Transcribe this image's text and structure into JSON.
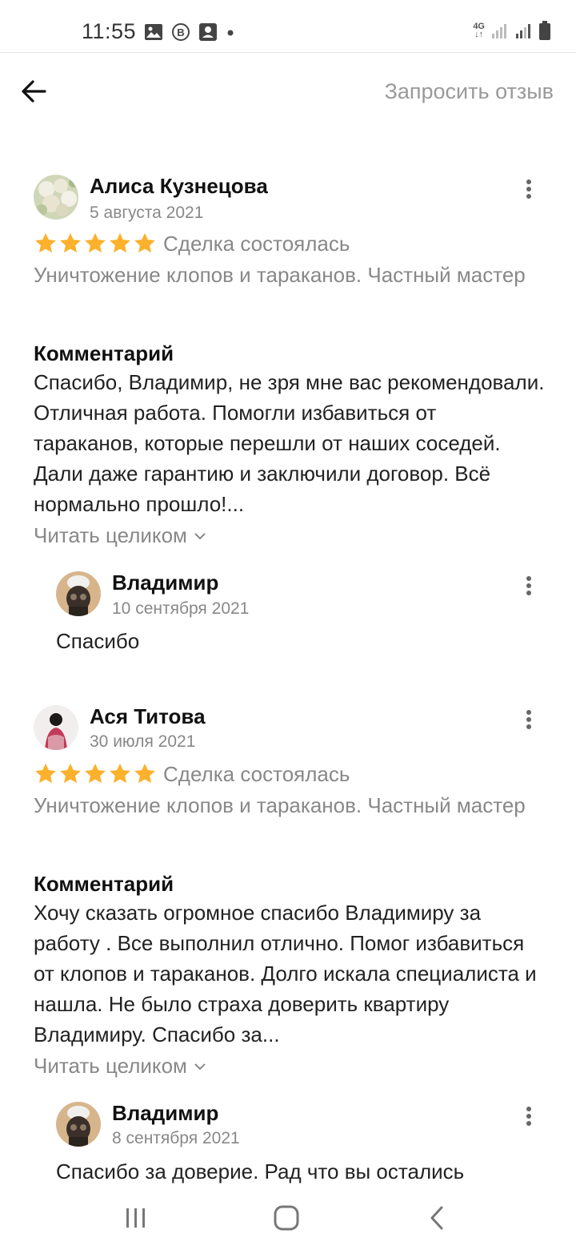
{
  "status_bar": {
    "time": "11:55",
    "network": "4G",
    "icons": [
      "gallery-icon",
      "b-badge-icon",
      "contact-icon",
      "dot-icon",
      "signal-icon",
      "signal-icon",
      "battery-icon"
    ]
  },
  "header": {
    "request_review_label": "Запросить отзыв",
    "back_icon": "arrow-left-icon"
  },
  "reviews": [
    {
      "author": "Алиса Кузнецова",
      "date": "5 августа 2021",
      "rating": 5,
      "deal_status": "Сделка состоялась",
      "service": "Уничтожение клопов и тараканов. Частный мастер",
      "comment_title": "Комментарий",
      "comment": "Спасибо, Владимир, не зря мне вас рекомендовали. Отличная работа. Помогли избавиться от тараканов, которые перешли от наших соседей. Дали даже гарантию и заключили договор. Всё нормально прошло!...",
      "read_more": "Читать целиком",
      "reply": {
        "author": "Владимир",
        "date": "10 сентября 2021",
        "text": "Спасибо"
      }
    },
    {
      "author": "Ася Титова",
      "date": "30 июля 2021",
      "rating": 5,
      "deal_status": "Сделка состоялась",
      "service": "Уничтожение клопов и тараканов. Частный мастер",
      "comment_title": "Комментарий",
      "comment": "Хочу сказать огромное спасибо Владимиру за работу . Все выполнил отлично. Помог избавиться от клопов и тараканов. Долго искала специалиста и нашла. Не было страха доверить квартиру Владимиру. Спасибо за...",
      "read_more": "Читать целиком",
      "reply": {
        "author": "Владимир",
        "date": "8 сентября 2021",
        "text": "Спасибо за доверие. Рад что вы остались"
      }
    }
  ],
  "colors": {
    "star": "#FBB12B",
    "muted_text": "#888888",
    "primary_text": "#111111"
  },
  "nav_bar": [
    "recents-icon",
    "home-icon",
    "back-icon"
  ]
}
